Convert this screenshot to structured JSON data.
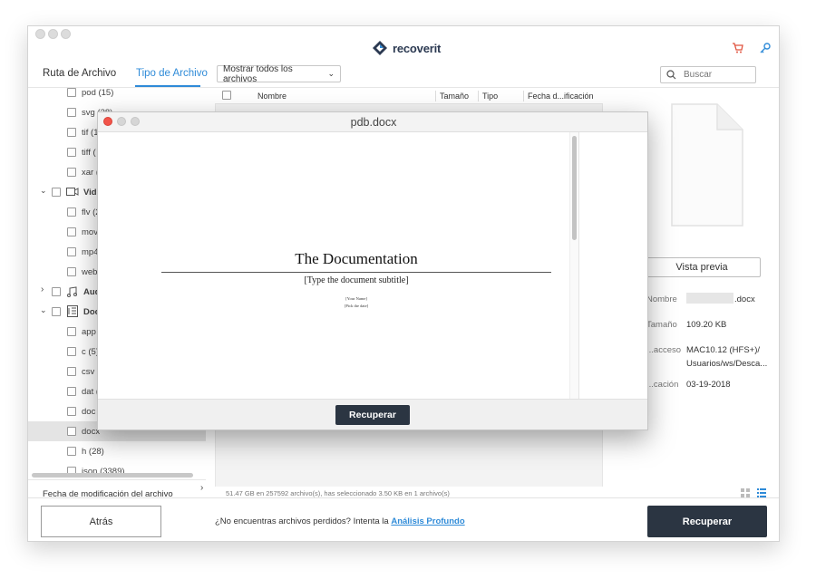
{
  "app": {
    "brand": "recoverit",
    "brand_color": "#2c3a52",
    "accent": "#2f8bd8"
  },
  "header": {
    "cart_icon": "cart-icon",
    "key_icon": "key-icon"
  },
  "tabs": [
    {
      "label": "Ruta de Archivo"
    },
    {
      "label": "Tipo de Archivo",
      "active": true
    }
  ],
  "filter": {
    "label": "Mostrar todos los archivos"
  },
  "search": {
    "placeholder": "Buscar"
  },
  "tree": [
    {
      "label": "pod (15)"
    },
    {
      "label": "svg (28)"
    },
    {
      "label": "tif (1"
    },
    {
      "label": "tiff ("
    },
    {
      "label": "xar ("
    },
    {
      "label": "Vide"
    },
    {
      "label": "flv (2"
    },
    {
      "label": "mov"
    },
    {
      "label": "mp4"
    },
    {
      "label": "web"
    },
    {
      "label": "Aud"
    },
    {
      "label": "Doc"
    },
    {
      "label": "app"
    },
    {
      "label": "c (5)"
    },
    {
      "label": "csv ("
    },
    {
      "label": "dat ("
    },
    {
      "label": "doc"
    },
    {
      "label": "docx"
    },
    {
      "label": "h (28)"
    },
    {
      "label": "json (3389)"
    }
  ],
  "sort": {
    "label": "Fecha de modificación del archivo"
  },
  "list": {
    "columns": [
      "Nombre",
      "Tamaño",
      "Tipo",
      "Fecha d...ificación"
    ],
    "status": "51.47 GB en 257592 archivo(s), has seleccionado 3.50 KB en 1 archivo(s)"
  },
  "preview": {
    "button": "Vista previa",
    "info": [
      {
        "label": "Nombre",
        "value": ".docx"
      },
      {
        "label": "Tamaño",
        "value": "109.20 KB"
      },
      {
        "label": "...acceso",
        "value": "MAC10.12 (HFS+)/",
        "value2": "Usuarios/ws/Desca..."
      },
      {
        "label": "...cación",
        "value": "03-19-2018"
      }
    ]
  },
  "bottom": {
    "back": "Atrás",
    "hint": "¿No encuentras archivos perdidos? Intenta la",
    "link": "Análisis Profundo",
    "recover": "Recuperar"
  },
  "modal": {
    "title": "pdb.docx",
    "doc_title": "The Documentation",
    "doc_subtitle": "[Type the document subtitle]",
    "doc_name": "[Your Name]",
    "doc_date": "[Pick the date]",
    "button": "Recuperar"
  }
}
